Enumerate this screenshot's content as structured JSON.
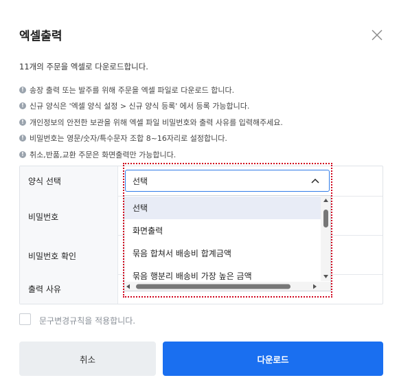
{
  "dialog": {
    "title": "엑셀출력",
    "subtitle": "11개의 주문을 엑셀로 다운로드합니다."
  },
  "notes": [
    "송장 출력 또는 발주를 위해 주문을 엑셀 파일로 다운로드 합니다.",
    "신규 양식은 '엑셀 양식 설정 > 신규 양식 등록' 에서 등록 가능합니다.",
    "개인정보의 안전한 보관을 위해 엑셀 파일 비밀번호와 출력 사유를 입력해주세요.",
    "비밀번호는 영문/숫자/특수문자 조합 8~16자리로 설정합니다.",
    "취소,반품,교환 주문은 화면출력만 가능합니다."
  ],
  "note_icon": "info-icon",
  "form": {
    "format_label": "양식 선택",
    "password_label": "비밀번호",
    "password_confirm_label": "비밀번호 확인",
    "reason_label": "출력 사유",
    "format_value": "선택",
    "options": [
      "선택",
      "화면출력",
      "묶음 합쳐서 배송비 합계금액",
      "묶음 행분리 배송비 가장 높은 금액"
    ]
  },
  "checkbox": {
    "label": "문구변경규칙을 적용합니다.",
    "checked": false
  },
  "buttons": {
    "cancel": "취소",
    "download": "다운로드"
  },
  "colors": {
    "primary": "#1a6ff0",
    "focus_border": "#2f7be8",
    "highlight_outline": "#d0021b"
  }
}
